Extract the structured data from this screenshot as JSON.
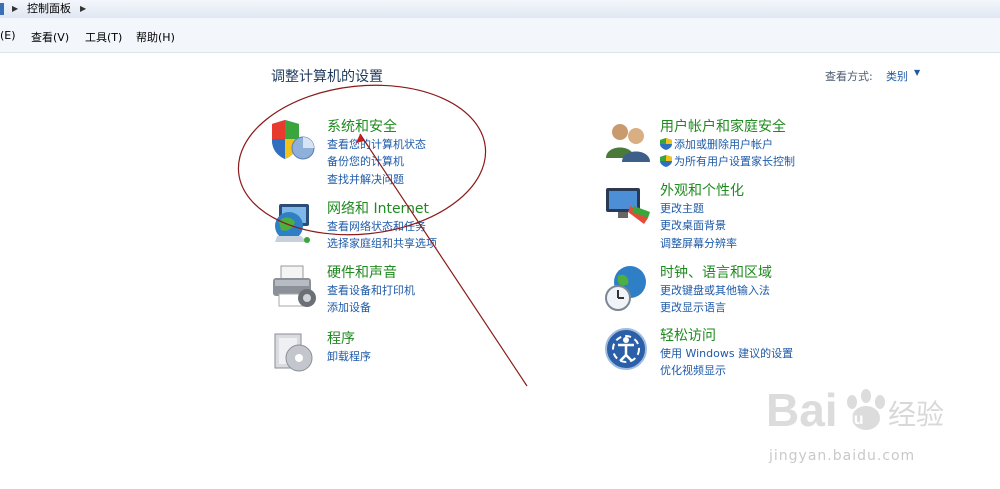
{
  "address_bar": {
    "breadcrumb": "控制面板"
  },
  "menu": [
    "(E)",
    "查看(V)",
    "工具(T)",
    "帮助(H)"
  ],
  "main": {
    "title": "调整计算机的设置",
    "view_by_label": "查看方式:",
    "view_by_value": "类别"
  },
  "categories": {
    "security": {
      "title": "系统和安全",
      "links": [
        "查看您的计算机状态",
        "备份您的计算机",
        "查找并解决问题"
      ]
    },
    "network": {
      "title": "网络和 Internet",
      "links": [
        "查看网络状态和任务",
        "选择家庭组和共享选项"
      ]
    },
    "hardware": {
      "title": "硬件和声音",
      "links": [
        "查看设备和打印机",
        "添加设备"
      ]
    },
    "programs": {
      "title": "程序",
      "links": [
        "卸载程序"
      ]
    },
    "users": {
      "title": "用户帐户和家庭安全",
      "links": [
        "添加或删除用户帐户",
        "为所有用户设置家长控制"
      ]
    },
    "appearance": {
      "title": "外观和个性化",
      "links": [
        "更改主题",
        "更改桌面背景",
        "调整屏幕分辨率"
      ]
    },
    "clock": {
      "title": "时钟、语言和区域",
      "links": [
        "更改键盘或其他输入法",
        "更改显示语言"
      ]
    },
    "ease": {
      "title": "轻松访问",
      "links": [
        "使用 Windows 建议的设置",
        "优化视频显示"
      ]
    }
  },
  "watermark": {
    "brand": "Bai du 经验",
    "url": "jingyan.baidu.com"
  },
  "colors": {
    "category_title": "#1f8a1f",
    "link": "#1e5aa8",
    "annotation": "#8b1a1a"
  }
}
